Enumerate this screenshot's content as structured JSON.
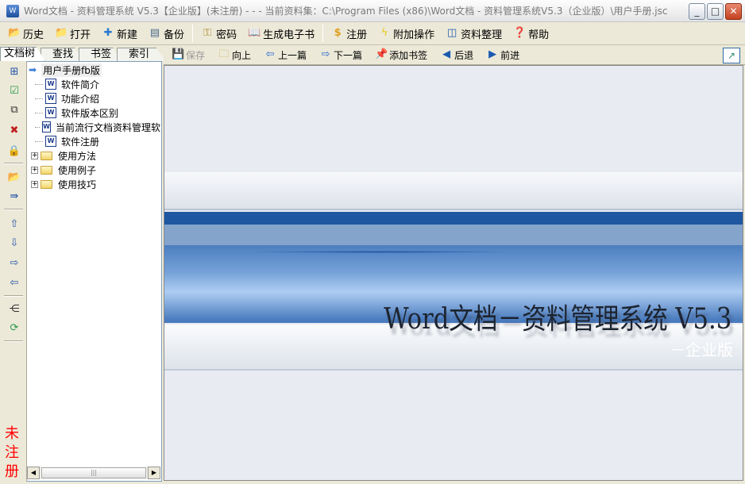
{
  "window": {
    "title": "Word文档 - 资料管理系统 V5.3【企业版】(未注册) - - - 当前资料集：C:\\Program Files (x86)\\Word文档 - 资料管理系统V5.3（企业版）\\用户手册.jsc",
    "app_icon": "W",
    "minimize": "_",
    "maximize": "□",
    "close": "✕"
  },
  "menu": [
    {
      "label": "历史",
      "icon": "history-icon"
    },
    {
      "label": "打开",
      "icon": "open-icon"
    },
    {
      "label": "新建",
      "icon": "new-icon"
    },
    {
      "label": "备份",
      "icon": "backup-icon"
    },
    {
      "label": "密码",
      "icon": "key-icon"
    },
    {
      "label": "生成电子书",
      "icon": "book-icon"
    },
    {
      "label": "注册",
      "icon": "dollar-icon"
    },
    {
      "label": "附加操作",
      "icon": "lightning-icon"
    },
    {
      "label": "资料整理",
      "icon": "columns-icon"
    },
    {
      "label": "帮助",
      "icon": "help-book-icon"
    }
  ],
  "left_tabs": [
    "文档树",
    "查找",
    "书签",
    "索引"
  ],
  "unregistered": "未注册",
  "tree": {
    "root": "用户手册fb版",
    "docs": [
      "软件简介",
      "功能介绍",
      "软件版本区别",
      "当前流行文档资料管理软",
      "软件注册"
    ],
    "folders": [
      "使用方法",
      "使用例子",
      "使用技巧"
    ]
  },
  "toolbar": {
    "save": "保存",
    "up": "向上",
    "prev": "上一篇",
    "next": "下一篇",
    "bookmark": "添加书签",
    "back": "后退",
    "forward": "前进"
  },
  "banner": {
    "title": "Word文档－资料管理系统 V5.3",
    "subtitle": "－企业版"
  }
}
